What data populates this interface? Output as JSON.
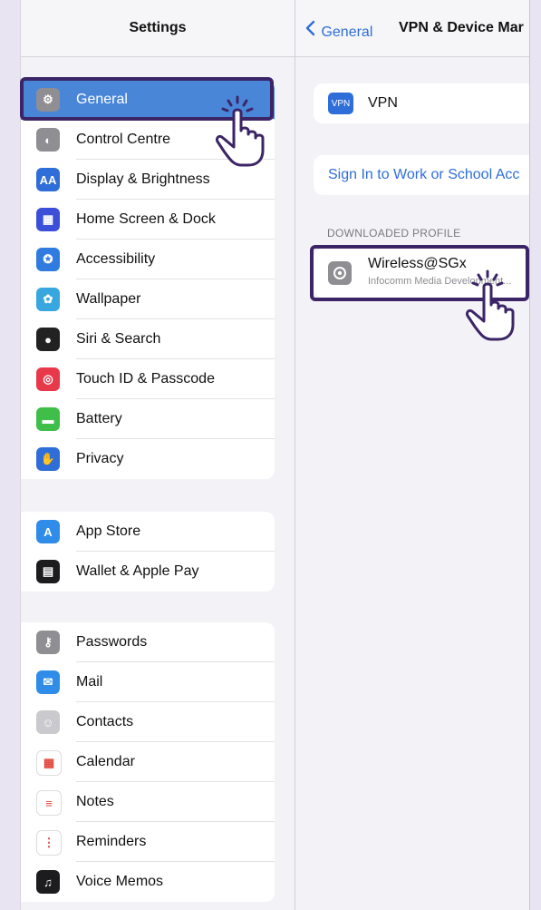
{
  "sidebar": {
    "title": "Settings",
    "groups": [
      {
        "items": [
          {
            "label": "General",
            "icon": "gear-icon",
            "color": "#8e8e93"
          },
          {
            "label": "Control Centre",
            "icon": "toggles-icon",
            "color": "#8e8e93"
          },
          {
            "label": "Display & Brightness",
            "icon": "text-size-icon",
            "color": "#2f6ed8"
          },
          {
            "label": "Home Screen & Dock",
            "icon": "app-grid-icon",
            "color": "#3b4fd8"
          },
          {
            "label": "Accessibility",
            "icon": "accessibility-icon",
            "color": "#2f7be0"
          },
          {
            "label": "Wallpaper",
            "icon": "flower-icon",
            "color": "#38a7e0"
          },
          {
            "label": "Siri & Search",
            "icon": "siri-icon",
            "color": "#222"
          },
          {
            "label": "Touch ID & Passcode",
            "icon": "fingerprint-icon",
            "color": "#e8394b"
          },
          {
            "label": "Battery",
            "icon": "battery-icon",
            "color": "#3fbf4a"
          },
          {
            "label": "Privacy",
            "icon": "hand-icon",
            "color": "#2f6ed8"
          }
        ]
      },
      {
        "items": [
          {
            "label": "App Store",
            "icon": "app-store-icon",
            "color": "#2f8ce8"
          },
          {
            "label": "Wallet & Apple Pay",
            "icon": "wallet-icon",
            "color": "#1c1c1e"
          }
        ]
      },
      {
        "items": [
          {
            "label": "Passwords",
            "icon": "key-icon",
            "color": "#8e8e93"
          },
          {
            "label": "Mail",
            "icon": "mail-icon",
            "color": "#2f8ce8"
          },
          {
            "label": "Contacts",
            "icon": "contacts-icon",
            "color": "#c9c9ce"
          },
          {
            "label": "Calendar",
            "icon": "calendar-icon",
            "color": "#ffffff"
          },
          {
            "label": "Notes",
            "icon": "notes-icon",
            "color": "#ffffff"
          },
          {
            "label": "Reminders",
            "icon": "reminders-icon",
            "color": "#ffffff"
          },
          {
            "label": "Voice Memos",
            "icon": "voice-memos-icon",
            "color": "#1c1c1e"
          }
        ]
      }
    ]
  },
  "main": {
    "back_label": "General",
    "title": "VPN & Device Mar",
    "vpn_label": "VPN",
    "vpn_icon_text": "VPN",
    "sign_in_label": "Sign In to Work or School Acc",
    "section_label": "DOWNLOADED PROFILE",
    "profile_name": "Wireless@SGx",
    "profile_sub": "Infocomm Media Development..."
  },
  "colors": {
    "selected": "#4a86d8",
    "highlight": "#3b2566",
    "link": "#2f6ed8"
  }
}
